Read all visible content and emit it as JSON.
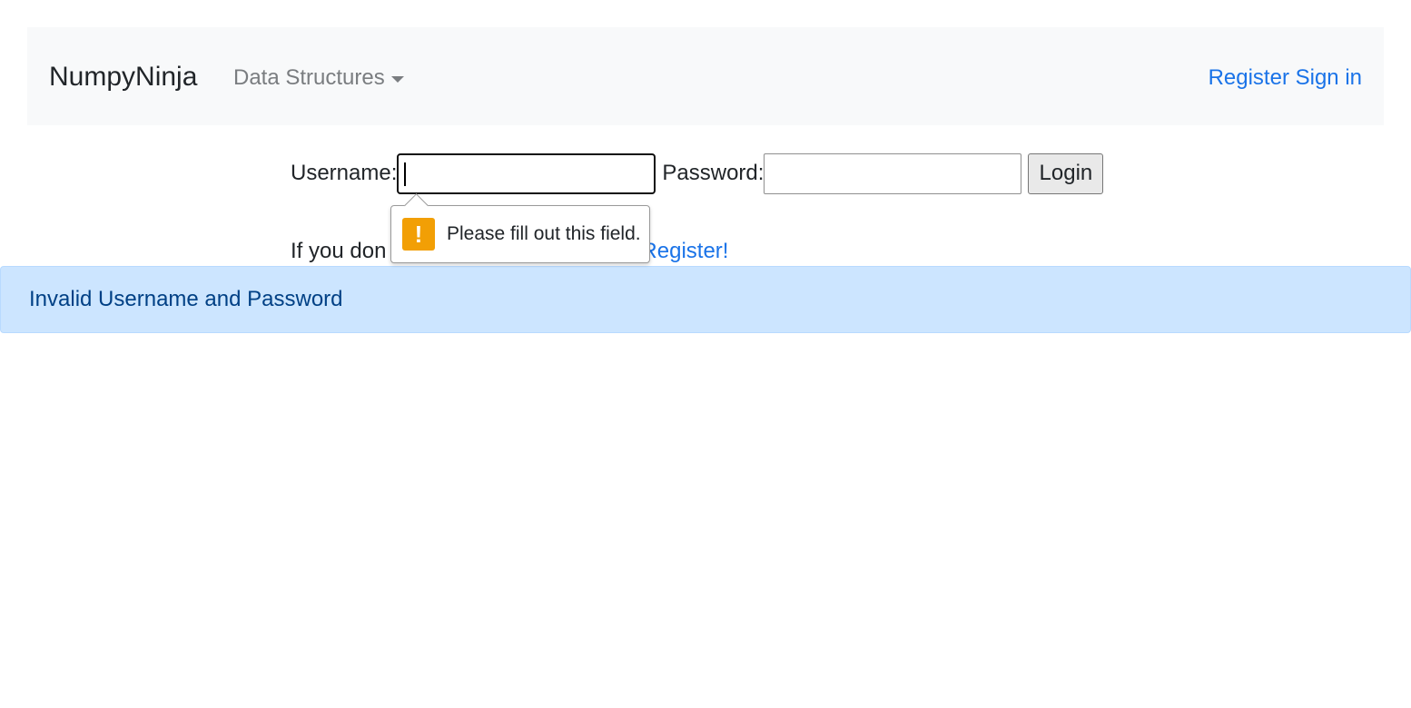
{
  "navbar": {
    "brand": "NumpyNinja",
    "dropdown_label": "Data Structures",
    "register_link": "Register",
    "signin_link": "Sign in"
  },
  "login_form": {
    "username_label": "Username:",
    "username_value": "",
    "password_label": "Password:",
    "password_value": "",
    "login_button": "Login"
  },
  "register_prompt": {
    "text": "If you don",
    "link": "Register!"
  },
  "validation_tooltip": {
    "message": "Please fill out this field.",
    "icon": "warning-icon",
    "icon_glyph": "!"
  },
  "alert": {
    "message": "Invalid Username and Password"
  },
  "colors": {
    "link": "#1a73e8",
    "navbar_bg": "#f8f9fa",
    "alert_bg": "#cce5ff",
    "alert_text": "#004085",
    "warning": "#f29f05"
  }
}
